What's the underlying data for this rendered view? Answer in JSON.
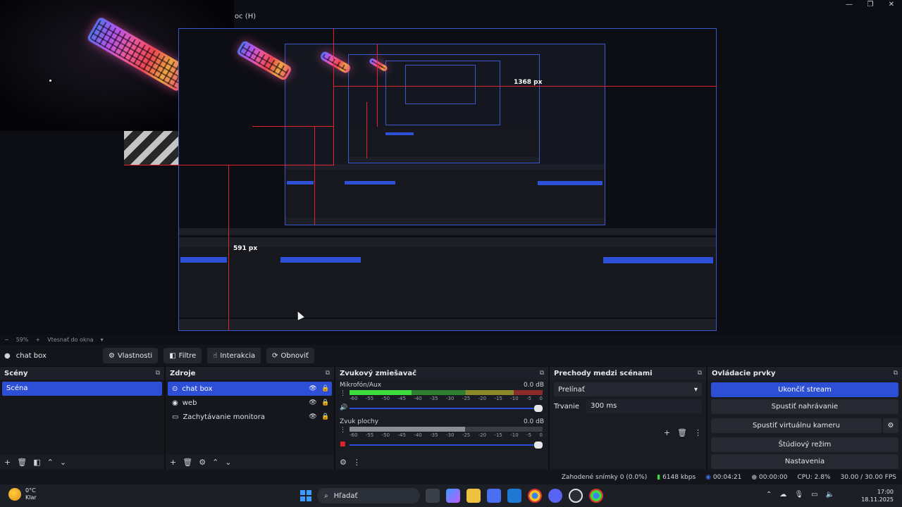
{
  "window": {
    "title_fragment": "oc (H)",
    "controls": [
      "—",
      "❐",
      "✕"
    ]
  },
  "preview": {
    "measure_large": "1368 px",
    "measure_small": "591 px",
    "nested_dock_labels": [
      "Scény",
      "Zdroje",
      "Zvukový zmiešavač",
      "Prechody medzi scénami",
      "Ovládacie prvky"
    ],
    "nested_scene": "Scéna",
    "nested_source": "chat box",
    "nested_buttons": [
      "Ukončiť stream",
      "Spustiť nahrávanie",
      "Spustiť virtuálnu kameru",
      "Štúdiový režim",
      "Nastavenia"
    ]
  },
  "zoombar": {
    "zoom": "59%",
    "mode": "Vtesnať do okna"
  },
  "source_toolbar": {
    "selected_source": "chat box",
    "buttons": [
      {
        "label": "Vlastnosti",
        "icon": "⚙"
      },
      {
        "label": "Filtre",
        "icon": "◧"
      },
      {
        "label": "Interakcia",
        "icon": "☝"
      },
      {
        "label": "Obnoviť",
        "icon": "⟳"
      }
    ]
  },
  "docks": {
    "scenes": {
      "title": "Scény",
      "items": [
        "Scéna"
      ]
    },
    "sources": {
      "title": "Zdroje",
      "items": [
        {
          "label": "chat box",
          "icon": "⊙",
          "active": true
        },
        {
          "label": "web",
          "icon": "◉",
          "active": false
        },
        {
          "label": "Zachytávanie monitora",
          "icon": "▭",
          "active": false
        }
      ]
    },
    "mixer": {
      "title": "Zvukový zmiešavač",
      "channels": [
        {
          "name": "Mikrofón/Aux",
          "db": "0.0 dB",
          "level": 0.32
        },
        {
          "name": "Zvuk plochy",
          "db": "0.0 dB",
          "level": 0.6
        }
      ],
      "ticks": [
        "-60",
        "-55",
        "-50",
        "-45",
        "-40",
        "-35",
        "-30",
        "-25",
        "-20",
        "-15",
        "-10",
        "-5",
        "0"
      ]
    },
    "transitions": {
      "title": "Prechody medzi scénami",
      "selected": "Prelínať",
      "duration_label": "Trvanie",
      "duration_value": "300 ms"
    },
    "controls": {
      "title": "Ovládacie prvky",
      "buttons": [
        "Ukončiť stream",
        "Spustiť nahrávanie",
        "Spustiť virtuálnu kameru",
        "Štúdiový režim",
        "Nastavenia"
      ]
    }
  },
  "status": {
    "dropped": "Zahodené snímky 0 (0.0%)",
    "bitrate": "6148 kbps",
    "stream_time": "00:04:21",
    "rec_time": "00:00:00",
    "cpu": "CPU: 2.8%",
    "fps": "30.00 / 30.00 FPS"
  },
  "taskbar": {
    "temp": "0°C",
    "weather": "Klar",
    "search": "Hľadať",
    "time": "17:00",
    "date": "18.11.2025"
  },
  "colors": {
    "accent": "#2d4fd6",
    "redline": "#e0222e",
    "meter_green": "#3ddc3d"
  }
}
